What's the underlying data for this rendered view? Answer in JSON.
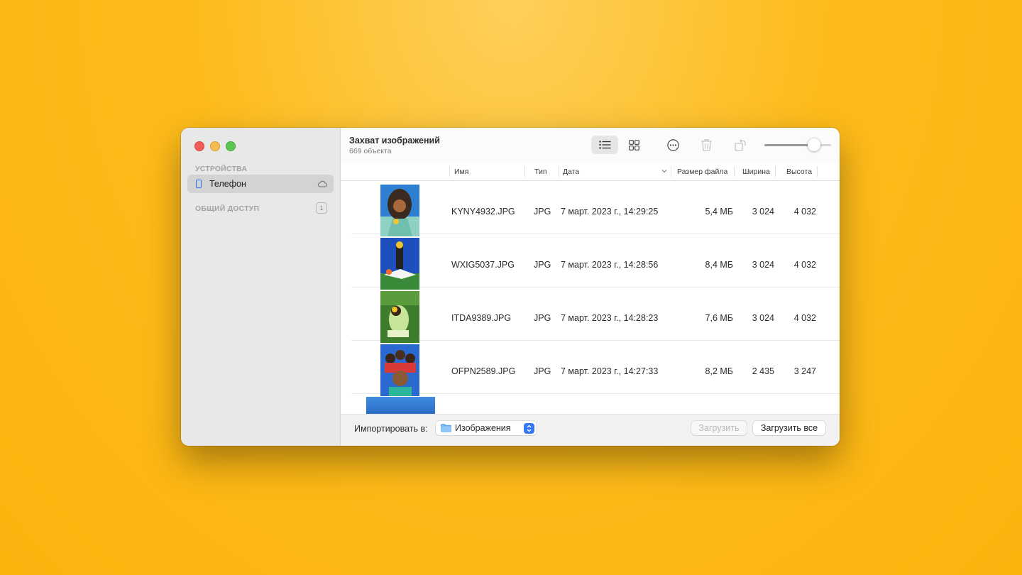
{
  "sidebar": {
    "devices_title": "УСТРОЙСТВА",
    "device_name": "Телефон",
    "shared_title": "ОБЩИЙ ДОСТУП",
    "shared_count": "1"
  },
  "toolbar": {
    "title": "Захват изображений",
    "subtitle": "669 объекта",
    "view_mode": "list",
    "thumbnail_size_fraction": 0.74
  },
  "table": {
    "columns": [
      "Имя",
      "Тип",
      "Дата",
      "Размер файла",
      "Ширина",
      "Высота"
    ],
    "sorted_by": "Дата",
    "rows": [
      {
        "name": "KYNY4932.JPG",
        "type": "JPG",
        "date": "7 март. 2023 г., 14:29:25",
        "size": "5,4 МБ",
        "width": "3 024",
        "height": "4 032"
      },
      {
        "name": "WXIG5037.JPG",
        "type": "JPG",
        "date": "7 март. 2023 г., 14:28:56",
        "size": "8,4 МБ",
        "width": "3 024",
        "height": "4 032"
      },
      {
        "name": "ITDA9389.JPG",
        "type": "JPG",
        "date": "7 март. 2023 г., 14:28:23",
        "size": "7,6 МБ",
        "width": "3 024",
        "height": "4 032"
      },
      {
        "name": "OFPN2589.JPG",
        "type": "JPG",
        "date": "7 март. 2023 г., 14:27:33",
        "size": "8,2 МБ",
        "width": "2 435",
        "height": "3 247"
      }
    ]
  },
  "footer": {
    "import_label": "Импортировать в:",
    "destination": "Изображения",
    "import_button": "Загрузить",
    "import_all_button": "Загрузить все"
  },
  "colors": {
    "accent": "#3478f6",
    "close": "#ee5f57",
    "minimize": "#f5bd4f",
    "maximize": "#5ec453",
    "background": "#fbb40e"
  }
}
